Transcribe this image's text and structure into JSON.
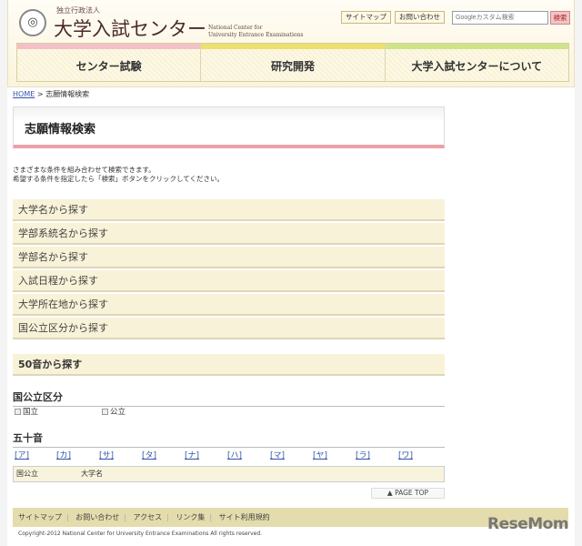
{
  "header": {
    "org_type": "独立行政法人",
    "org_name": "大学入試センター",
    "org_en_1": "National Center for",
    "org_en_2": "University Entrance Examinations",
    "sitemap": "サイトマップ",
    "contact": "お問い合わせ",
    "search_placeholder": "Googleカスタム検索",
    "search_button": "検索"
  },
  "nav": [
    "センター試験",
    "研究開発",
    "大学入試センターについて"
  ],
  "breadcrumb": {
    "home": "HOME",
    "sep": ">",
    "current": "志願情報検索"
  },
  "page_title": "志願情報検索",
  "intro": [
    "さまざまな条件を組み合わせて検索できます。",
    "希望する条件を指定したら「検索」ボタンをクリックしてください。"
  ],
  "search_sections": [
    "大学名から探す",
    "学部系統名から探す",
    "学部名から探す",
    "入試日程から探す",
    "大学所在地から探す",
    "国公立区分から探す"
  ],
  "kana_section": {
    "title": "50音から探す",
    "category_heading": "国公立区分",
    "checkboxes": [
      "国立",
      "公立"
    ],
    "kana_heading": "五十音",
    "kana": [
      "[ア]",
      "[カ]",
      "[サ]",
      "[タ]",
      "[ナ]",
      "[ハ]",
      "[マ]",
      "[ヤ]",
      "[ラ]",
      "[ワ]"
    ],
    "table_headers": [
      "国公立",
      "大学名"
    ]
  },
  "page_top": "▲  PAGE TOP",
  "footer": {
    "links": [
      "サイトマップ",
      "お問い合わせ",
      "アクセス",
      "リンク集",
      "サイト利用規約"
    ],
    "copyright": "Copyright-2012 National Center for University Entrance Examinations All rights reserved."
  },
  "watermark": "ReseMom"
}
